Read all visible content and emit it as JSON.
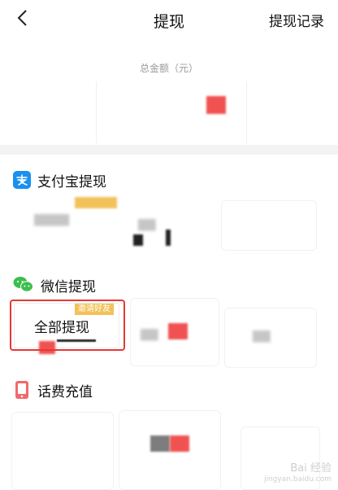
{
  "nav": {
    "title": "提现",
    "right_action": "提现记录"
  },
  "summary": {
    "label": "总金额（元）"
  },
  "sections": {
    "alipay": {
      "title": "支付宝提现",
      "icon": "alipay-icon",
      "color": "#1a90f0"
    },
    "wechat": {
      "title": "微信提现",
      "icon": "wechat-icon",
      "color": "#3cbf4d"
    },
    "recharge": {
      "title": "话费充值",
      "icon": "phone-icon",
      "color": "#f06a6a"
    }
  },
  "wechat_options": {
    "selected": {
      "label": "全部提现",
      "badge": "邀请好友"
    }
  },
  "colors": {
    "accent_red": "#e53935",
    "badge_yellow": "#f2c25a"
  },
  "watermark": {
    "brand": "Bai 经验",
    "url": "jingyan.baidu.com"
  }
}
